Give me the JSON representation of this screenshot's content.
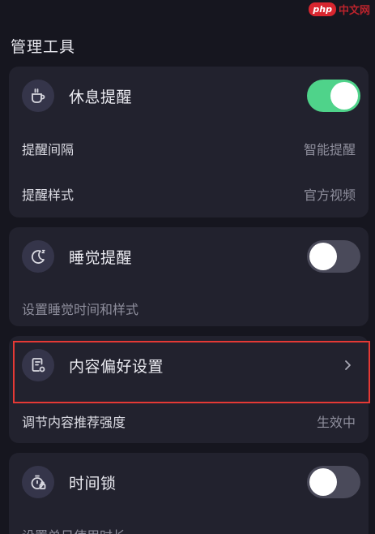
{
  "watermark": {
    "logo": "php",
    "text": "中文网"
  },
  "section_title": "管理工具",
  "rest_reminder": {
    "label": "休息提醒",
    "enabled": true,
    "interval_label": "提醒间隔",
    "interval_value": "智能提醒",
    "style_label": "提醒样式",
    "style_value": "官方视频"
  },
  "sleep_reminder": {
    "label": "睡觉提醒",
    "enabled": false,
    "description": "设置睡觉时间和样式"
  },
  "content_pref": {
    "label": "内容偏好设置",
    "sub_label": "调节内容推荐强度",
    "sub_value": "生效中"
  },
  "time_lock": {
    "label": "时间锁",
    "enabled": false,
    "description": "设置单日使用时长"
  },
  "colors": {
    "background": "#16161f",
    "card": "#22222e",
    "toggle_on": "#4fd38a",
    "toggle_off": "#4a4a5a",
    "highlight": "#e53935"
  }
}
